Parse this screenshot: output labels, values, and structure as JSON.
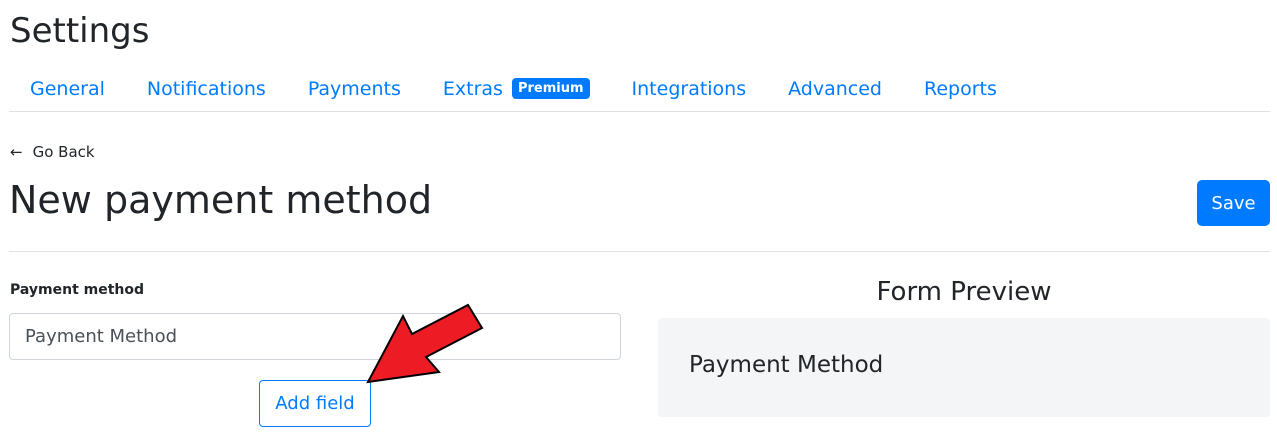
{
  "header": {
    "title": "Settings"
  },
  "tabs": [
    {
      "label": "General"
    },
    {
      "label": "Notifications"
    },
    {
      "label": "Payments"
    },
    {
      "label": "Extras",
      "badge": "Premium"
    },
    {
      "label": "Integrations"
    },
    {
      "label": "Advanced"
    },
    {
      "label": "Reports"
    }
  ],
  "nav": {
    "go_back_label": "Go Back",
    "go_back_icon": "arrow-left-icon"
  },
  "page": {
    "heading": "New payment method",
    "save_label": "Save"
  },
  "form": {
    "payment_method_label": "Payment method",
    "payment_method_value": "Payment Method",
    "add_field_label": "Add field"
  },
  "preview": {
    "title": "Form Preview",
    "field_label": "Payment Method"
  },
  "colors": {
    "accent": "#007bff",
    "annotation_arrow": "#ed1c24",
    "preview_bg": "#f4f5f6"
  }
}
